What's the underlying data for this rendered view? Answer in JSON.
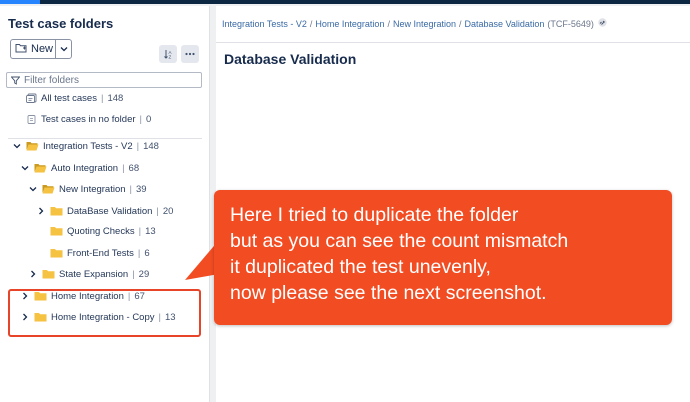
{
  "sidebar": {
    "title": "Test case folders",
    "new_button": "New",
    "filter_placeholder": "Filter folders",
    "special": [
      {
        "label": "All test cases",
        "count": "148"
      },
      {
        "label": "Test cases in no folder",
        "count": "0"
      }
    ],
    "tree": [
      {
        "label": "Integration Tests - V2",
        "count": "148",
        "expanded": true
      },
      {
        "label": "Auto Integration",
        "count": "68",
        "expanded": true
      },
      {
        "label": "New Integration",
        "count": "39",
        "expanded": true
      },
      {
        "label": "DataBase Validation",
        "count": "20",
        "expanded": false
      },
      {
        "label": "Quoting Checks",
        "count": "13"
      },
      {
        "label": "Front-End Tests",
        "count": "6"
      },
      {
        "label": "State Expansion",
        "count": "29",
        "expanded": false
      },
      {
        "label": "Home Integration",
        "count": "67",
        "expanded": false
      },
      {
        "label": "Home Integration - Copy",
        "count": "13",
        "expanded": false
      }
    ]
  },
  "breadcrumb": {
    "items": [
      "Integration Tests - V2",
      "Home Integration",
      "New Integration",
      "Database Validation"
    ],
    "separator": "/",
    "key": "(TCF-5649)"
  },
  "main": {
    "title": "Database Validation"
  },
  "callout": {
    "lines": [
      "Here I tried to duplicate the folder",
      "but as you can see the count mismatch",
      "it duplicated the test unevenly,",
      "now please see the next screenshot."
    ],
    "color": "#f24c23"
  },
  "colors": {
    "highlight": "#e8442a",
    "folder": "#f5c242",
    "link": "#3a6aa5"
  }
}
